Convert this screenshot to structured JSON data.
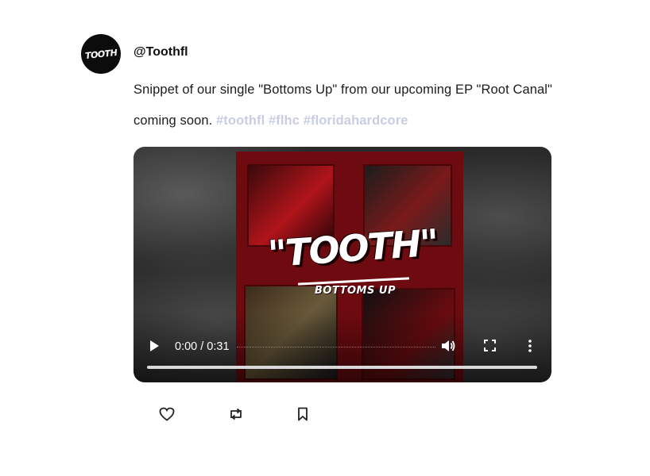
{
  "post": {
    "avatar_logo_text": "TOOTH",
    "handle": "@Toothfl",
    "text": "Snippet of our single \"Bottoms Up\" from our upcoming EP \"Root Canal\" coming soon. ",
    "hashtags": "#toothfl #flhc #floridahardcore"
  },
  "video": {
    "poster_logo": "\"TOOTH\"",
    "poster_subtitle": "BOTTOMS UP",
    "time": "0:00 / 0:31",
    "progress": 0,
    "icons": [
      "play-icon",
      "volume-icon",
      "fullscreen-icon",
      "more-vertical-icon"
    ]
  },
  "actions": {
    "icons": [
      "heart-icon",
      "repost-icon",
      "bookmark-icon"
    ]
  },
  "colors": {
    "hashtag": "#c9cde4",
    "poster_red": "#6e0b10"
  }
}
